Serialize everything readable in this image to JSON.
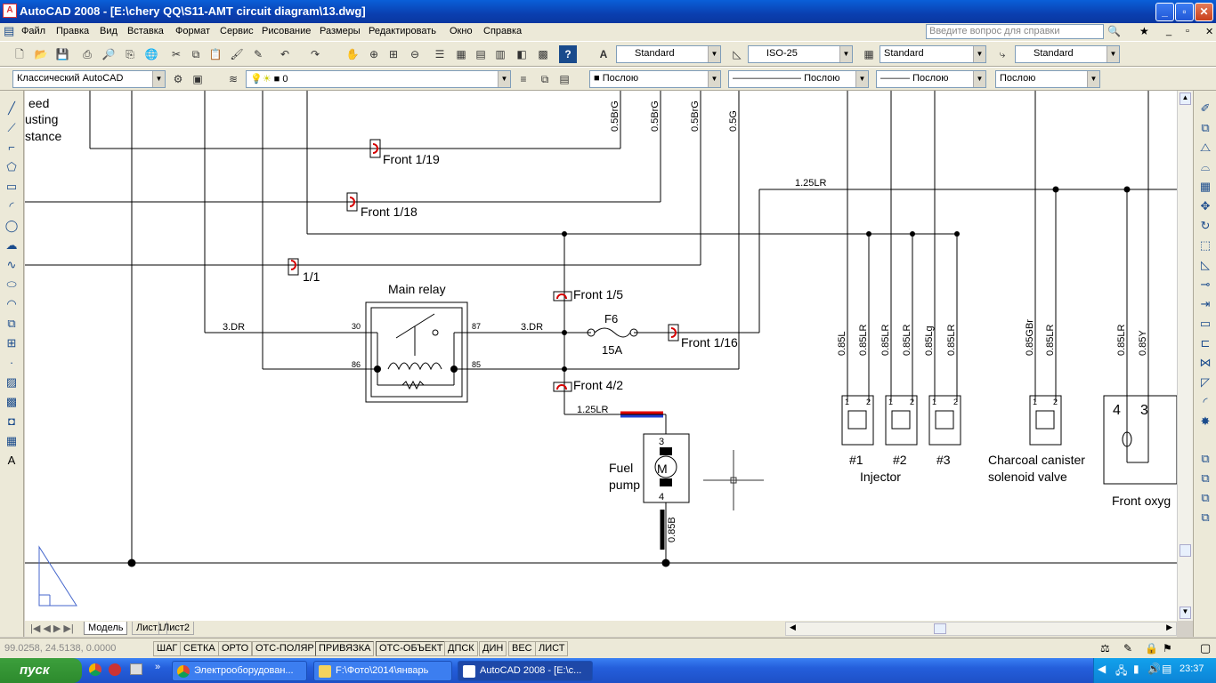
{
  "window": {
    "title": "AutoCAD 2008 - [E:\\chery QQ\\S11-AMT circuit diagram\\13.dwg]",
    "btn_minimize": "_",
    "btn_restore": "▫",
    "btn_close": "✕"
  },
  "menu": {
    "items": [
      "Файл",
      "Правка",
      "Вид",
      "Вставка",
      "Формат",
      "Сервис",
      "Рисование",
      "Размеры",
      "Редактировать",
      "Окно",
      "Справка"
    ],
    "help_placeholder": "Введите вопрос для справки"
  },
  "toolbar1": {
    "text_style": "Standard",
    "dim_style": "ISO-25",
    "table_style": "Standard",
    "multileader_style": "Standard"
  },
  "toolbar2": {
    "workspace": "Классический AutoCAD",
    "layer": "0",
    "color": "Послою",
    "linetype": "Послою",
    "lineweight": "Послою",
    "plotstyle": "Послою"
  },
  "drawing": {
    "labels": {
      "partial_top1": "eed",
      "partial_top2": "usting",
      "partial_top3": "stance",
      "front_1_19": "Front 1/19",
      "front_1_18": "Front 1/18",
      "front_1_1": "1/1",
      "main_relay": "Main relay",
      "front_1_5": "Front 1/5",
      "front_1_16": "Front 1/16",
      "front_4_2": "Front 4/2",
      "fuse_name": "F6",
      "fuse_rating": "15A",
      "fuel_pump_1": "Fuel",
      "fuel_pump_2": "pump",
      "inj1": "#1",
      "inj2": "#2",
      "inj3": "#3",
      "injector": "Injector",
      "canister_1": "Charcoal canister",
      "canister_2": "solenoid valve",
      "front_oxy": "Front oxyg",
      "pin30": "30",
      "pin87": "87",
      "pin86": "86",
      "pin85": "85",
      "pin3": "3",
      "pin4": "4",
      "oxy4": "4",
      "oxy3": "3",
      "inj_pin1": "1",
      "inj_pin2": "2"
    },
    "wires": {
      "w3dr_left": "3.DR",
      "w3dr_right": "3.DR",
      "w125lr_top": "1.25LR",
      "w125lr_pump": "1.25LR",
      "v058rg_1": "0.5BrG",
      "v058rg_2": "0.5BrG",
      "v058rg_3": "0.5BrG",
      "v05g": "0.5G",
      "v085l": "0.85L",
      "v085lr_1": "0.85LR",
      "v085lr_2": "0.85LR",
      "v085lr_3": "0.85LR",
      "v085lg": "0.85Lg",
      "v085lr_4": "0.85LR",
      "v085gbr": "0.85GBr",
      "v085lr_5": "0.85LR",
      "v085lr_6": "0.85LR",
      "v085y": "0.85Y",
      "v085b": "0.85B"
    }
  },
  "tabs": {
    "model": "Модель",
    "layout1": "Лист1",
    "layout2": "Лист2"
  },
  "status": {
    "coords": "99.0258, 24.5138, 0.0000",
    "buttons": [
      "ШАГ",
      "СЕТКА",
      "ОРТО",
      "ОТС-ПОЛЯР",
      "ПРИВЯЗКА",
      "ОТС-ОБЪЕКТ",
      "ДПСК",
      "ДИН",
      "ВЕС",
      "ЛИСТ"
    ]
  },
  "taskbar": {
    "start": "пуск",
    "tasks": [
      "Электрооборудован...",
      "F:\\Фото\\2014\\январь",
      "AutoCAD 2008 - [E:\\c..."
    ],
    "clock": "23:37"
  },
  "colors": {
    "accent": "#0a3fb0",
    "relay_mark": "#d40000",
    "fuel_red": "#e00000",
    "fuel_blue": "#1f3fd1"
  }
}
